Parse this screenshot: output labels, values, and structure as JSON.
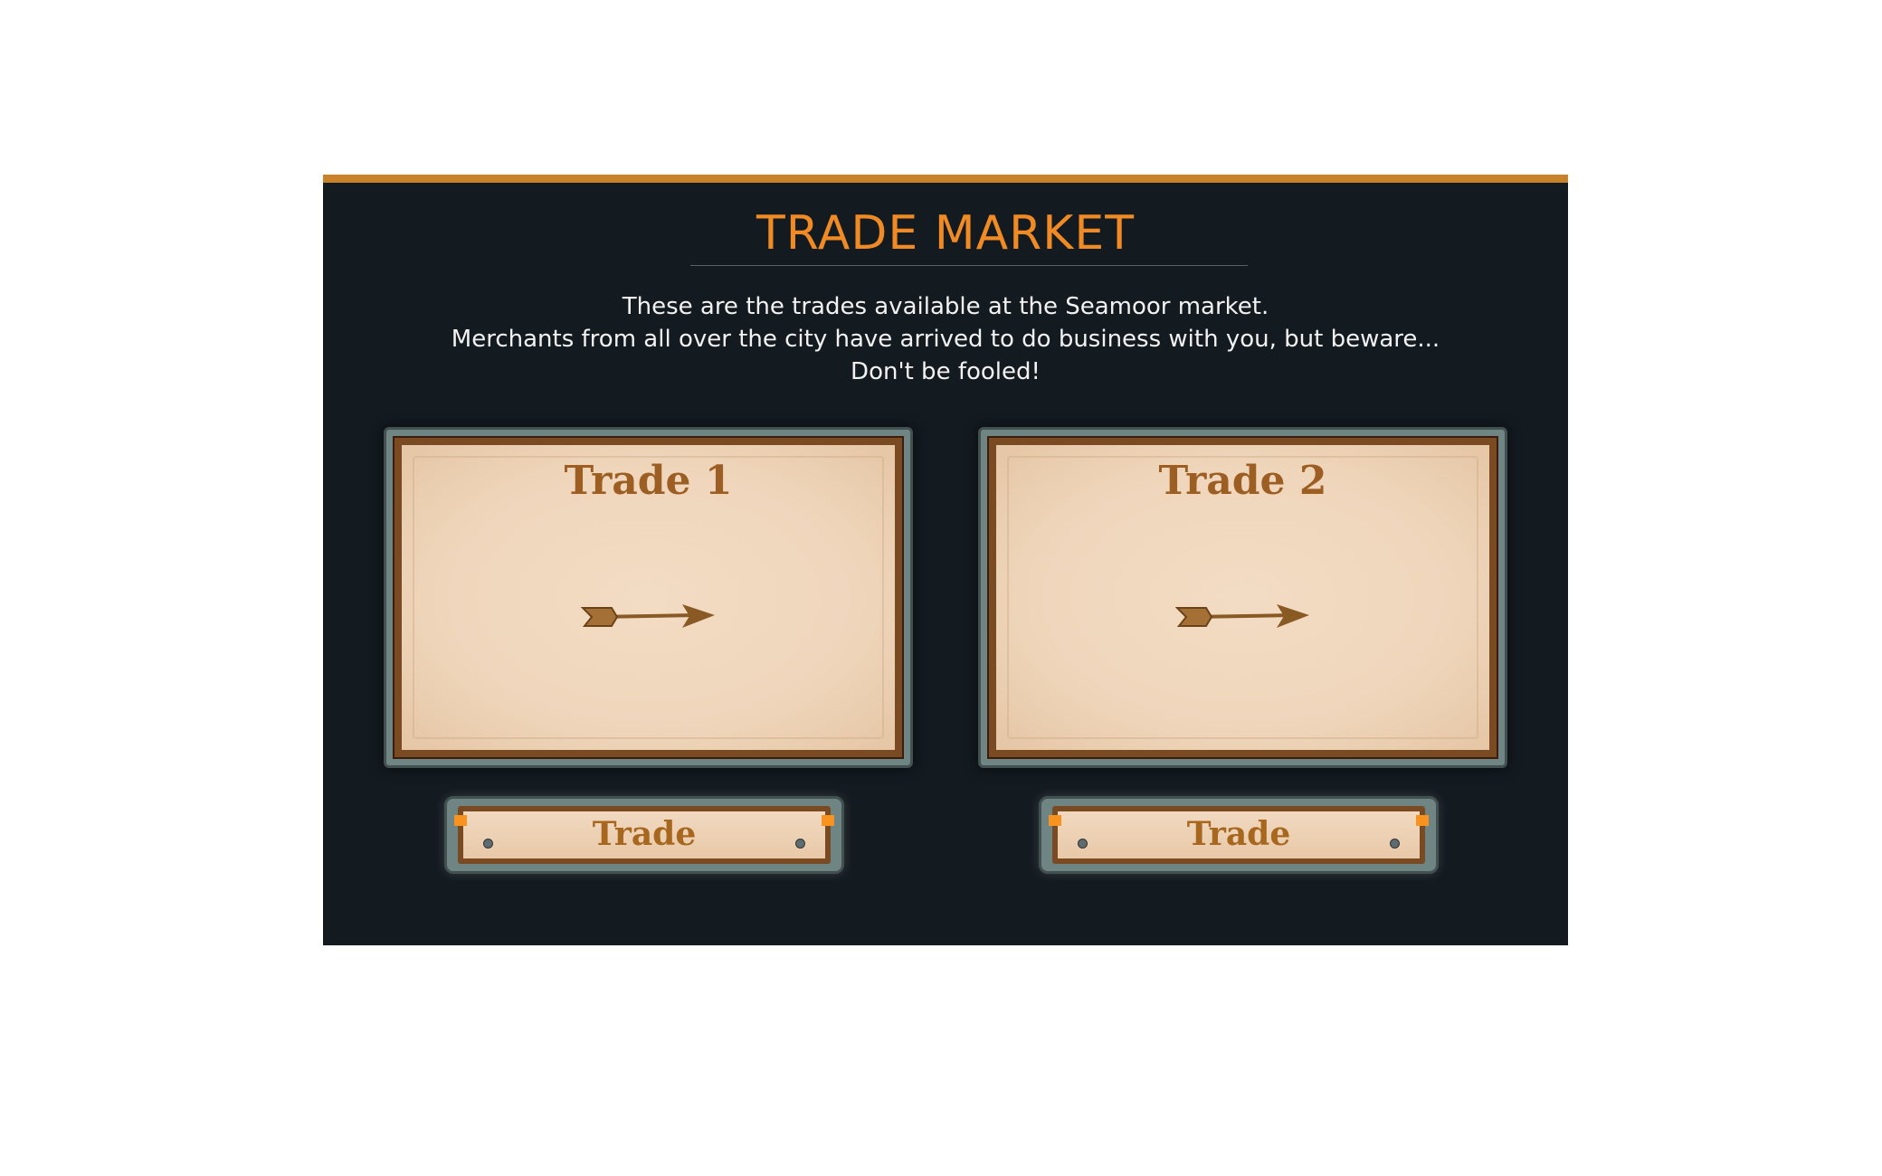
{
  "header": {
    "title": "TRADE MARKET",
    "description": [
      "These are the trades available at the Seamoor market.",
      "Merchants from all over the city have arrived to do business with you, but beware...",
      "Don't be fooled!"
    ]
  },
  "trades": [
    {
      "title": "Trade 1",
      "icon": "arrow-icon",
      "button_label": "Trade"
    },
    {
      "title": "Trade 2",
      "icon": "arrow-icon",
      "button_label": "Trade"
    }
  ],
  "colors": {
    "accent": "#f08a24",
    "top_bar": "#c8832a",
    "background": "#131a20",
    "parchment": "#f3dcc4",
    "trade_text": "#9c5e22"
  }
}
